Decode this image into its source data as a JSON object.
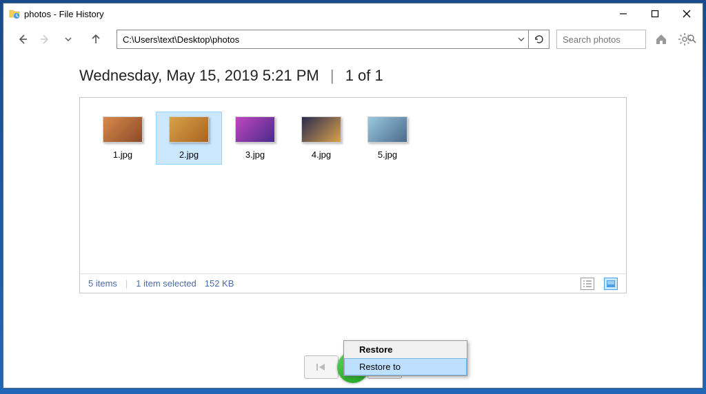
{
  "titlebar": {
    "title": "photos - File History"
  },
  "nav": {
    "path": "C:\\Users\\text\\Desktop\\photos",
    "search_placeholder": "Search photos"
  },
  "version": {
    "datetime": "Wednesday, May 15, 2019 5:21 PM",
    "position": "1 of 1"
  },
  "files": [
    {
      "name": "1.jpg",
      "selected": false,
      "variant": "v1"
    },
    {
      "name": "2.jpg",
      "selected": true,
      "variant": "v2"
    },
    {
      "name": "3.jpg",
      "selected": false,
      "variant": "v3"
    },
    {
      "name": "4.jpg",
      "selected": false,
      "variant": "v4"
    },
    {
      "name": "5.jpg",
      "selected": false,
      "variant": "v5"
    }
  ],
  "status": {
    "count": "5 items",
    "selection": "1 item selected",
    "size": "152 KB"
  },
  "context_menu": {
    "restore": "Restore",
    "restore_to": "Restore to"
  }
}
